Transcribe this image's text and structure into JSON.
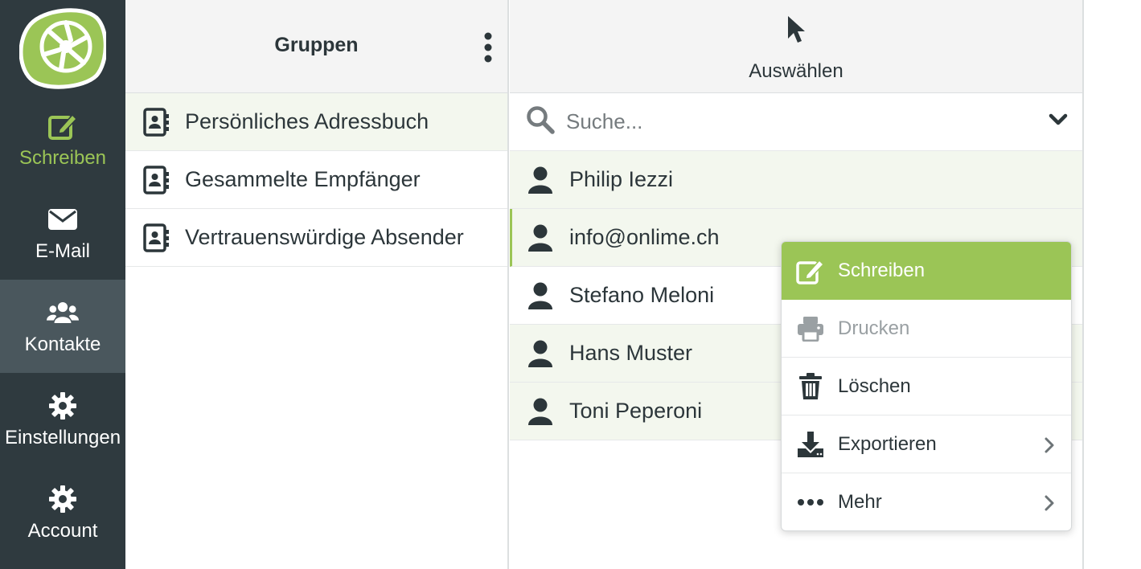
{
  "colors": {
    "accent": "#9bc556",
    "nav_bg": "#2f3a3f",
    "nav_active": "#4a575d",
    "row_highlight": "#f3f7ee"
  },
  "nav": {
    "items": [
      {
        "label": "Schreiben",
        "icon": "compose-icon"
      },
      {
        "label": "E-Mail",
        "icon": "envelope-icon"
      },
      {
        "label": "Kontakte",
        "icon": "users-icon"
      },
      {
        "label": "Einstellungen",
        "icon": "gear-icon"
      },
      {
        "label": "Account",
        "icon": "gear-icon"
      }
    ]
  },
  "groups": {
    "title": "Gruppen",
    "items": [
      {
        "label": "Persönliches Adressbuch",
        "icon": "address-book-icon"
      },
      {
        "label": "Gesammelte Empfänger",
        "icon": "address-book-icon"
      },
      {
        "label": "Vertrauenswürdige Absender",
        "icon": "address-book-icon"
      }
    ]
  },
  "contacts": {
    "select_label": "Auswählen",
    "search": {
      "placeholder": "Suche...",
      "value": ""
    },
    "items": [
      {
        "name": "Philip Iezzi",
        "icon": "user-icon"
      },
      {
        "name": "info@onlime.ch",
        "icon": "user-icon"
      },
      {
        "name": "Stefano Meloni",
        "icon": "user-icon"
      },
      {
        "name": "Hans Muster",
        "icon": "user-icon"
      },
      {
        "name": "Toni Peperoni",
        "icon": "user-icon"
      }
    ]
  },
  "popup": {
    "items": [
      {
        "label": "Schreiben",
        "icon": "compose-icon"
      },
      {
        "label": "Drucken",
        "icon": "printer-icon"
      },
      {
        "label": "Löschen",
        "icon": "trash-icon"
      },
      {
        "label": "Exportieren",
        "icon": "download-icon"
      },
      {
        "label": "Mehr",
        "icon": "ellipsis-icon"
      }
    ]
  }
}
